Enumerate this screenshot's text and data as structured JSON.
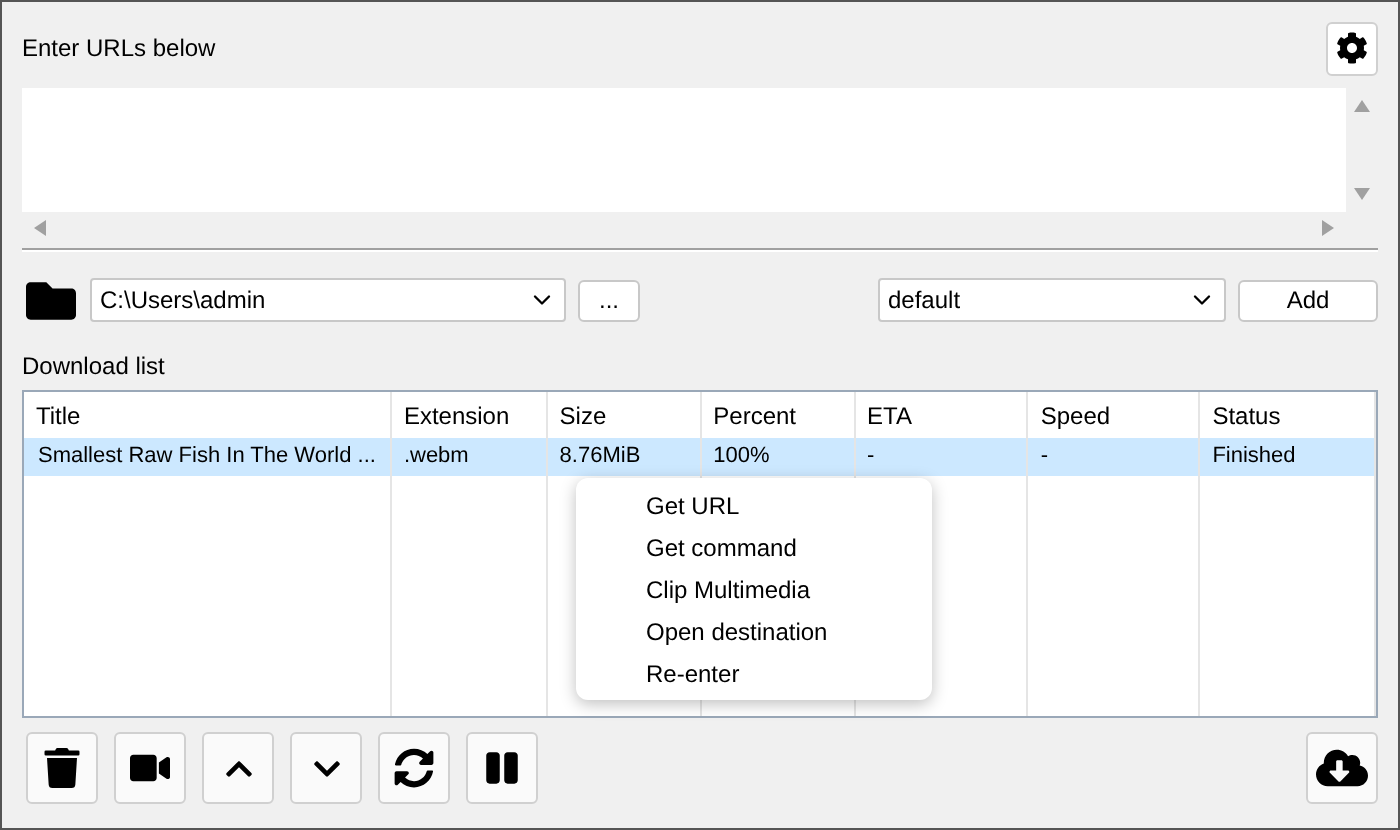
{
  "url_input": {
    "label": "Enter URLs below"
  },
  "destination": {
    "path": "C:\\Users\\admin",
    "browse_button": "..."
  },
  "preset": {
    "value": "default",
    "add_button": "Add"
  },
  "download_list": {
    "label": "Download list",
    "columns": [
      "Title",
      "Extension",
      "Size",
      "Percent",
      "ETA",
      "Speed",
      "Status"
    ],
    "rows": [
      {
        "cells": [
          "Smallest Raw Fish In The World ...",
          ".webm",
          "8.76MiB",
          "100%",
          "-",
          "-",
          "Finished"
        ],
        "selected": true
      }
    ]
  },
  "context_menu": [
    "Get URL",
    "Get command",
    "Clip Multimedia",
    "Open destination",
    "Re-enter"
  ]
}
